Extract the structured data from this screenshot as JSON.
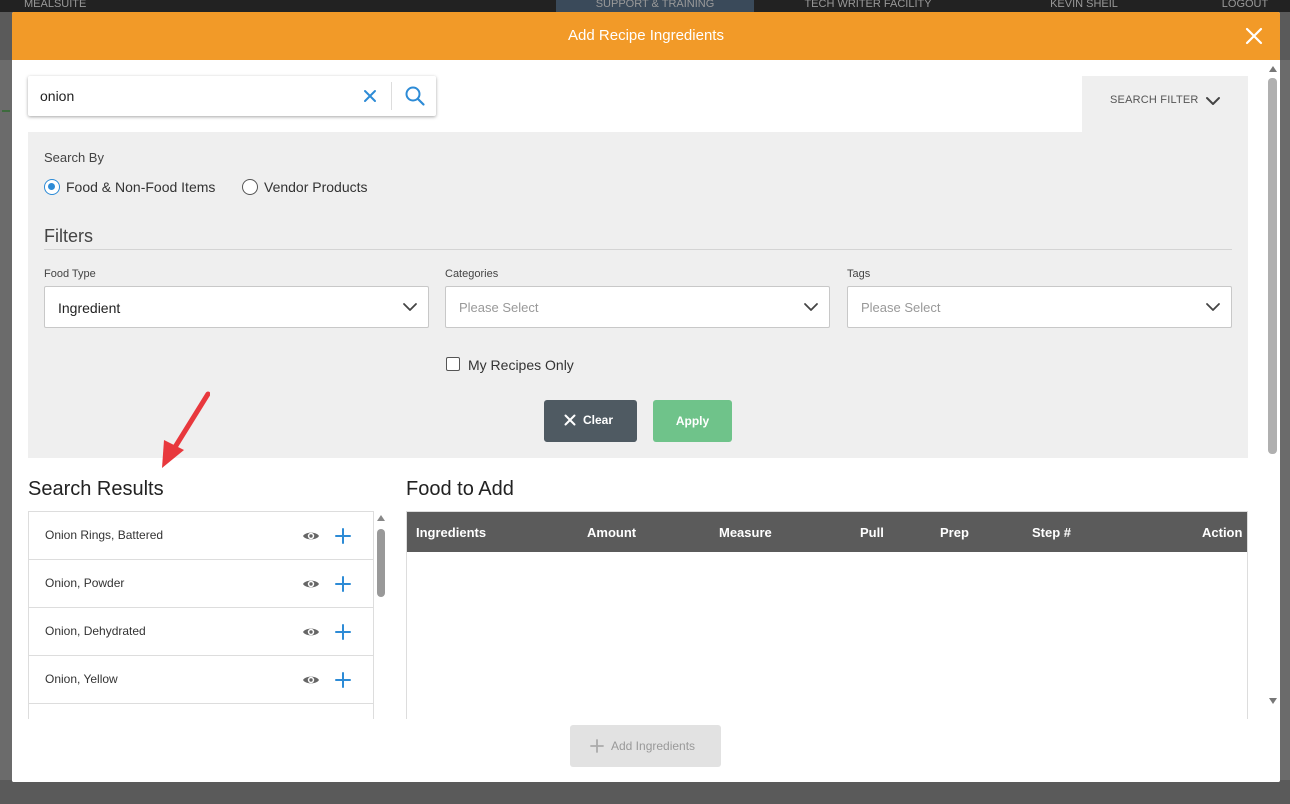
{
  "background": {
    "topbar_items": [
      "MEALSUITE",
      "SUPPORT & TRAINING",
      "TECH WRITER FACILITY",
      "KEVIN SHEIL",
      "LOGOUT"
    ]
  },
  "modal": {
    "title": "Add Recipe Ingredients",
    "header_color": "#f29a28",
    "close_icon": "close-icon"
  },
  "search": {
    "value": "onion",
    "clear_icon": "clear-icon",
    "search_icon": "search-icon"
  },
  "filter_toggle": {
    "label": "SEARCH FILTER",
    "icon": "chevron-down-icon"
  },
  "filters": {
    "search_by_label": "Search By",
    "options": [
      {
        "label": "Food & Non-Food Items",
        "selected": true
      },
      {
        "label": "Vendor Products",
        "selected": false
      }
    ],
    "heading": "Filters",
    "food_type": {
      "label": "Food Type",
      "value": "Ingredient"
    },
    "categories": {
      "label": "Categories",
      "placeholder": "Please Select"
    },
    "tags": {
      "label": "Tags",
      "placeholder": "Please Select"
    },
    "my_recipes_only": {
      "label": "My Recipes Only",
      "checked": false
    },
    "clear_label": "Clear",
    "apply_label": "Apply"
  },
  "results": {
    "title": "Search Results",
    "items": [
      {
        "name": "Onion Rings, Battered"
      },
      {
        "name": "Onion, Powder"
      },
      {
        "name": "Onion, Dehydrated"
      },
      {
        "name": "Onion, Yellow"
      }
    ]
  },
  "food_to_add": {
    "title": "Food to Add",
    "columns": [
      "Ingredients",
      "Amount",
      "Measure",
      "Pull",
      "Prep",
      "Step #",
      "Action"
    ]
  },
  "footer": {
    "add_label": "Add Ingredients"
  }
}
